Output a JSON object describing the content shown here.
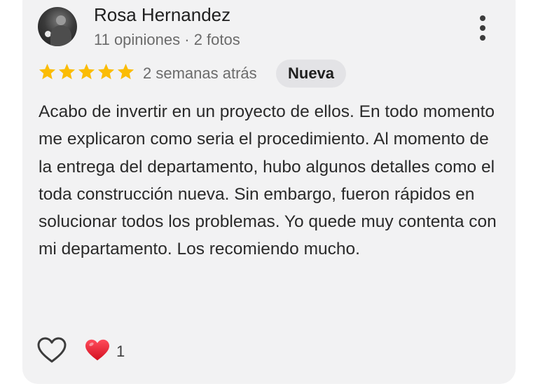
{
  "review": {
    "author_name": "Rosa Hernandez",
    "author_meta": "11 opiniones · 2 fotos",
    "rating": 5,
    "max_rating": 5,
    "time_ago": "2 semanas atrás",
    "badge": "Nueva",
    "text": "Acabo de invertir en un proyecto de ellos. En todo momento me explicaron como seria el procedimiento. Al momento de la entrega del departamento, hubo algunos detalles como el toda construcción nueva. Sin embargo, fueron rápidos en solucionar todos los problemas. Yo quede muy contenta con mi departamento. Los recomiendo mucho."
  },
  "reactions": {
    "heart_count": "1"
  },
  "colors": {
    "star": "#fbbc04",
    "card_bg": "#f2f2f3",
    "badge_bg": "#e3e3e6",
    "heart_red": "#e0182b"
  },
  "icons": {
    "menu": "more-vert-icon",
    "like": "heart-outline-icon",
    "reaction": "red-heart-icon",
    "star": "star-icon"
  }
}
